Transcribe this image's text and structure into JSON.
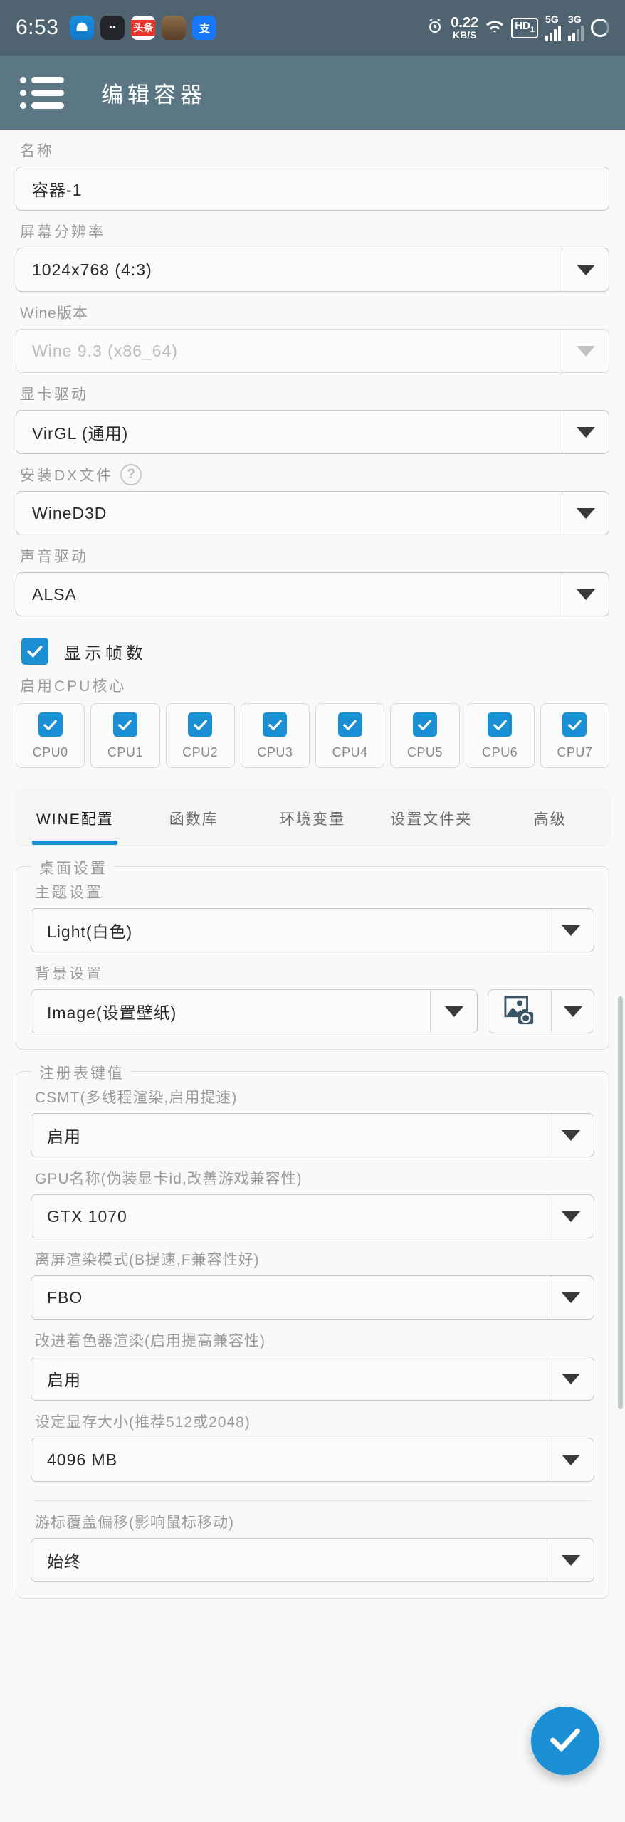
{
  "statusbar": {
    "time": "6:53",
    "app_icons": [
      "qq-browser-icon",
      "dark-app-icon",
      "toutiao-icon",
      "game-app-icon",
      "alipay-icon"
    ],
    "alarm_icon": "alarm-clock-icon",
    "net_speed_value": "0.22",
    "net_speed_unit": "KB/S",
    "wifi_icon": "wifi-icon",
    "hd_badge": "HD",
    "hd_sub": "1",
    "sim1_label": "5G",
    "sim2_label": "3G",
    "battery_icon": "battery-circle-icon"
  },
  "appbar": {
    "menu_icon": "list-menu-icon",
    "title": "编辑容器"
  },
  "form": {
    "name": {
      "label": "名称",
      "value": "容器-1"
    },
    "resolution": {
      "label": "屏幕分辨率",
      "value": "1024x768 (4:3)"
    },
    "wine_version": {
      "label": "Wine版本",
      "value": "Wine 9.3 (x86_64)",
      "disabled": true
    },
    "graphics_driver": {
      "label": "显卡驱动",
      "value": "VirGL (通用)"
    },
    "dx_files": {
      "label": "安装DX文件",
      "help_icon": "question-mark-icon",
      "value": "WineD3D"
    },
    "sound_driver": {
      "label": "声音驱动",
      "value": "ALSA"
    },
    "show_fps": {
      "label": "显示帧数",
      "checked": true
    },
    "cpu_cores": {
      "label": "启用CPU核心",
      "cores": [
        {
          "label": "CPU0",
          "checked": true
        },
        {
          "label": "CPU1",
          "checked": true
        },
        {
          "label": "CPU2",
          "checked": true
        },
        {
          "label": "CPU3",
          "checked": true
        },
        {
          "label": "CPU4",
          "checked": true
        },
        {
          "label": "CPU5",
          "checked": true
        },
        {
          "label": "CPU6",
          "checked": true
        },
        {
          "label": "CPU7",
          "checked": true
        }
      ]
    }
  },
  "tabs": [
    {
      "label": "WINE配置",
      "active": true
    },
    {
      "label": "函数库",
      "active": false
    },
    {
      "label": "环境变量",
      "active": false
    },
    {
      "label": "设置文件夹",
      "active": false
    },
    {
      "label": "高级",
      "active": false
    }
  ],
  "desktop_group": {
    "legend": "桌面设置",
    "theme": {
      "label": "主题设置",
      "value": "Light(白色)"
    },
    "background": {
      "label": "背景设置",
      "value": "Image(设置壁纸)",
      "picker_icon": "image-camera-icon"
    }
  },
  "registry_group": {
    "legend": "注册表键值",
    "fields": [
      {
        "label": "CSMT(多线程渲染,启用提速)",
        "value": "启用"
      },
      {
        "label": "GPU名称(伪装显卡id,改善游戏兼容性)",
        "value": "GTX 1070"
      },
      {
        "label": "离屏渲染模式(B提速,F兼容性好)",
        "value": "FBO"
      },
      {
        "label": "改进着色器渲染(启用提高兼容性)",
        "value": "启用"
      },
      {
        "label": "设定显存大小(推荐512或2048)",
        "value": "4096 MB"
      }
    ],
    "cursor_offset": {
      "label": "游标覆盖偏移(影响鼠标移动)",
      "value": "始终"
    }
  },
  "fab": {
    "icon": "check-icon"
  },
  "colors": {
    "accent": "#1b8fd4",
    "appbar": "#5b7784",
    "statusbar": "#4f6470"
  }
}
